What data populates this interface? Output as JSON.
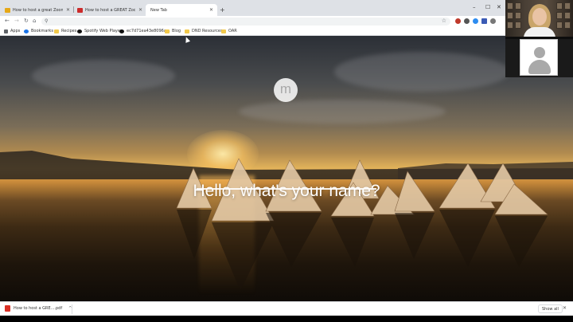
{
  "tabs": [
    {
      "title": "How to host a great Zoom meet",
      "favicon_color": "#e6a817",
      "active": false
    },
    {
      "title": "How to host a GREAT Zoom mee",
      "favicon_color": "#cc2b2b",
      "active": false
    },
    {
      "title": "New Tab",
      "favicon_color": "",
      "active": true
    }
  ],
  "new_tab_icon": "plus-icon",
  "toolbar": {
    "back_icon": "←",
    "forward_icon": "→",
    "reload_icon": "↻",
    "home_icon": "⌂",
    "search_glyph": "⚲",
    "bookmark_star": "☆"
  },
  "bookmarks": [
    {
      "label": "Apps",
      "color": "#5f6368"
    },
    {
      "label": "Bookmarks",
      "color": "#1a73e8"
    },
    {
      "label": "Recipes",
      "color": "#f2c94c"
    },
    {
      "label": "Spotify Web Player",
      "color": "#111111"
    },
    {
      "label": "ec7d71ea43e8096a...",
      "color": "#111111"
    },
    {
      "label": "Blog",
      "color": "#f2c94c"
    },
    {
      "label": "DND Resources",
      "color": "#f2c94c"
    },
    {
      "label": "OAR",
      "color": "#f2c94c"
    }
  ],
  "new_tab_page": {
    "logo_letter": "m",
    "greeting": "Hello, what's your name?",
    "name_value": ""
  },
  "download_bar": {
    "file_label": "How to host a GRE....pdf",
    "show_all": "Show all",
    "close": "✕"
  },
  "colors": {
    "accent": "#1a73e8",
    "pdf": "#d93025"
  }
}
